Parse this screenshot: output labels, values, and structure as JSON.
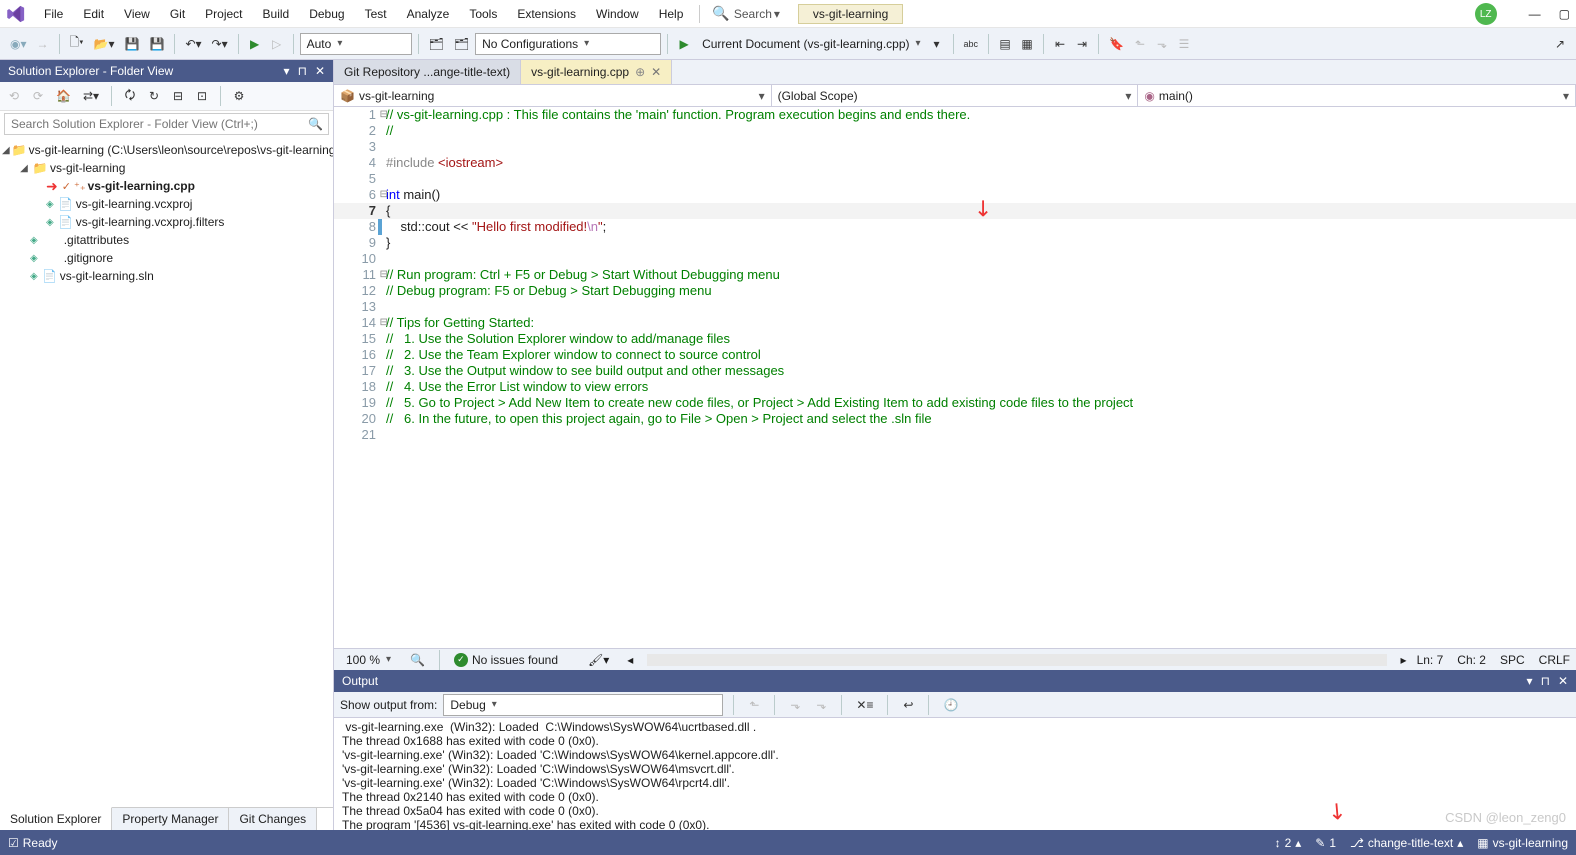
{
  "menus": [
    "File",
    "Edit",
    "View",
    "Git",
    "Project",
    "Build",
    "Debug",
    "Test",
    "Analyze",
    "Tools",
    "Extensions",
    "Window",
    "Help"
  ],
  "search_label": "Search",
  "project_context": "vs-git-learning",
  "user_initials": "LZ",
  "toolbar": {
    "config_auto": "Auto",
    "config_none": "No Configurations",
    "run_target": "Current Document (vs-git-learning.cpp)"
  },
  "solution_explorer": {
    "title": "Solution Explorer - Folder View",
    "search_placeholder": "Search Solution Explorer - Folder View (Ctrl+;)",
    "root": "vs-git-learning (C:\\Users\\leon\\source\\repos\\vs-git-learning)",
    "folder": "vs-git-learning",
    "files": {
      "cpp": "vs-git-learning.cpp",
      "vcxproj": "vs-git-learning.vcxproj",
      "filters": "vs-git-learning.vcxproj.filters",
      "gitattributes": ".gitattributes",
      "gitignore": ".gitignore",
      "sln": "vs-git-learning.sln"
    },
    "tabs": [
      "Solution Explorer",
      "Property Manager",
      "Git Changes"
    ]
  },
  "tabs": {
    "repo": "Git Repository ...ange-title-text)",
    "active": "vs-git-learning.cpp"
  },
  "nav": {
    "project": "vs-git-learning",
    "scope": "(Global Scope)",
    "func": "main()"
  },
  "code": {
    "l1": "// vs-git-learning.cpp : This file contains the 'main' function. Program execution begins and ends there.",
    "l2": "//",
    "l4": "#include <iostream>",
    "l6_a": "int",
    "l6_b": " main()",
    "l7": "{",
    "l8_a": "    std::cout << ",
    "l8_b": "\"Hello first modified!",
    "l8_c": "\\n",
    "l8_d": "\"",
    "l8_e": ";",
    "l9": "}",
    "l11": "// Run program: Ctrl + F5 or Debug > Start Without Debugging menu",
    "l12": "// Debug program: F5 or Debug > Start Debugging menu",
    "l14": "// Tips for Getting Started: ",
    "l15": "//   1. Use the Solution Explorer window to add/manage files",
    "l16": "//   2. Use the Team Explorer window to connect to source control",
    "l17": "//   3. Use the Output window to see build output and other messages",
    "l18": "//   4. Use the Error List window to view errors",
    "l19": "//   5. Go to Project > Add New Item to create new code files, or Project > Add Existing Item to add existing code files to the project",
    "l20": "//   6. In the future, to open this project again, go to File > Open > Project and select the .sln file"
  },
  "code_status": {
    "zoom": "100 %",
    "issues": "No issues found",
    "ln": "Ln: 7",
    "ch": "Ch: 2",
    "spc": "SPC",
    "crlf": "CRLF"
  },
  "output": {
    "title": "Output",
    "from_label": "Show output from:",
    "from_value": "Debug",
    "lines": [
      " vs-git-learning.exe  (Win32): Loaded  C:\\Windows\\SysWOW64\\ucrtbased.dll .",
      "The thread 0x1688 has exited with code 0 (0x0).",
      "'vs-git-learning.exe' (Win32): Loaded 'C:\\Windows\\SysWOW64\\kernel.appcore.dll'.",
      "'vs-git-learning.exe' (Win32): Loaded 'C:\\Windows\\SysWOW64\\msvcrt.dll'.",
      "'vs-git-learning.exe' (Win32): Loaded 'C:\\Windows\\SysWOW64\\rpcrt4.dll'.",
      "The thread 0x2140 has exited with code 0 (0x0).",
      "The thread 0x5a04 has exited with code 0 (0x0).",
      "The program '[4536] vs-git-learning.exe' has exited with code 0 (0x0)."
    ]
  },
  "statusbar": {
    "ready": "Ready",
    "up": "2",
    "pencil": "1",
    "branch": "change-title-text",
    "repo": "vs-git-learning"
  },
  "watermark": "CSDN @leon_zeng0"
}
